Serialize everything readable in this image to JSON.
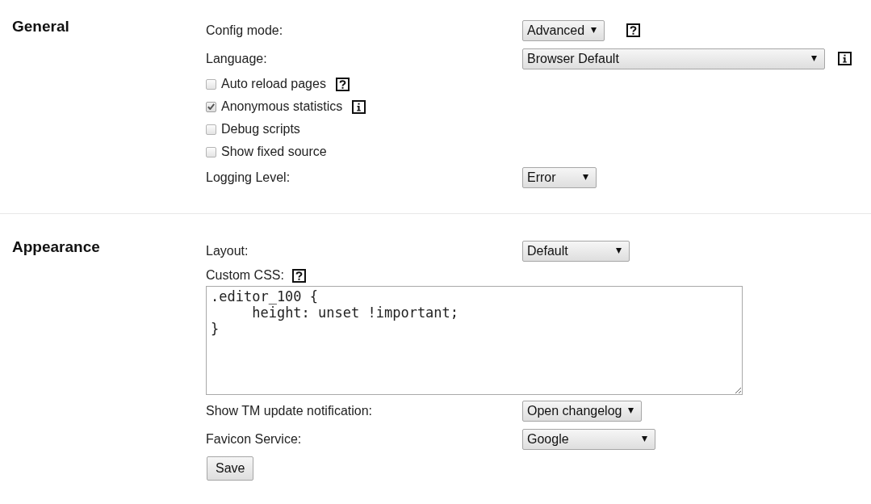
{
  "sections": [
    {
      "title": "General",
      "rows": [
        {
          "kind": "select",
          "label": "Config mode:",
          "value": "Advanced",
          "hint": {
            "kind": "help"
          }
        },
        {
          "kind": "select",
          "label": "Language:",
          "value": "Browser Default",
          "hint": {
            "kind": "info"
          }
        },
        {
          "kind": "checkbox",
          "label": "Auto reload pages",
          "checked": false,
          "hint": {
            "kind": "help"
          }
        },
        {
          "kind": "checkbox",
          "label": "Anonymous statistics",
          "checked": true,
          "hint": {
            "kind": "info"
          }
        },
        {
          "kind": "checkbox",
          "label": "Debug scripts",
          "checked": false
        },
        {
          "kind": "checkbox",
          "label": "Show fixed source",
          "checked": false
        },
        {
          "kind": "select",
          "label": "Logging Level:",
          "value": "Error"
        }
      ]
    },
    {
      "title": "Appearance",
      "rows": [
        {
          "kind": "select",
          "label": "Layout:",
          "value": "Default"
        },
        {
          "kind": "textarea",
          "label": "Custom CSS:",
          "hint": {
            "kind": "help"
          },
          "value": ".editor_100 {\n     height: unset !important;\n}"
        },
        {
          "kind": "select",
          "label": "Show TM update notification:",
          "value": "Open changelog"
        },
        {
          "kind": "select",
          "label": "Favicon Service:",
          "value": "Google"
        },
        {
          "kind": "button",
          "label": "Save"
        }
      ]
    }
  ]
}
